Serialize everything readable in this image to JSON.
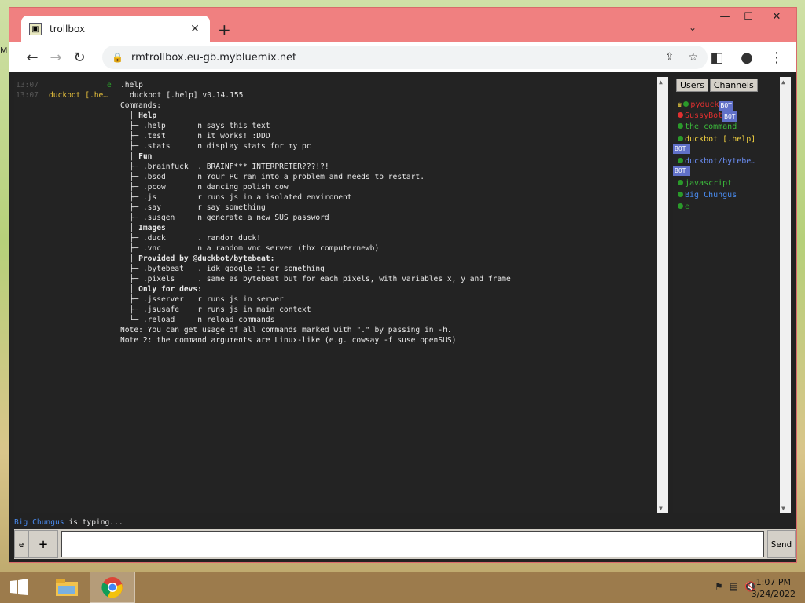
{
  "browser": {
    "tab_title": "trollbox",
    "tab_close": "✕",
    "new_tab": "+",
    "url": "rmtrollbox.eu-gb.mybluemix.net"
  },
  "desktop_label": "M",
  "chat": {
    "rows": [
      {
        "ts": "13:07",
        "nick": "e",
        "text": ".help",
        "cls": ""
      },
      {
        "ts": "13:07",
        "nick": "duckbot [.he…",
        "text": "duckbot [.help] v0.14.155",
        "cls": ""
      },
      {
        "text": "Commands:",
        "cls": ""
      },
      {
        "text": "  │ Help",
        "cls": "bold"
      },
      {
        "text": "  ├─ .help       n says this text",
        "cls": ""
      },
      {
        "text": "  ├─ .test       n it works! :DDD",
        "cls": ""
      },
      {
        "text": "  ├─ .stats      n display stats for my pc",
        "cls": ""
      },
      {
        "text": "  │ Fun",
        "cls": "bold"
      },
      {
        "text": "  ├─ .brainfuck  . BRAINF*** INTERPRETER???!?!",
        "cls": ""
      },
      {
        "text": "  ├─ .bsod       n Your PC ran into a problem and needs to restart.",
        "cls": ""
      },
      {
        "text": "  ├─ .pcow       n dancing polish cow",
        "cls": ""
      },
      {
        "text": "  ├─ .js         r runs js in a isolated enviroment",
        "cls": ""
      },
      {
        "text": "  ├─ .say        r say something",
        "cls": ""
      },
      {
        "text": "  ├─ .susgen     n generate a new SUS password",
        "cls": ""
      },
      {
        "text": "  │ Images",
        "cls": "bold"
      },
      {
        "text": "  ├─ .duck       . random duck!",
        "cls": ""
      },
      {
        "text": "  ├─ .vnc        n a random vnc server (thx computernewb)",
        "cls": ""
      },
      {
        "text": "  │ Provided by @duckbot/bytebeat:",
        "cls": "bold"
      },
      {
        "text": "  ├─ .bytebeat   . idk google it or something",
        "cls": ""
      },
      {
        "text": "  ├─ .pixels     . same as bytebeat but for each pixels, with variables x, y and frame",
        "cls": ""
      },
      {
        "text": "  │ Only for devs:",
        "cls": "bold"
      },
      {
        "text": "  ├─ .jsserver   r runs js in server",
        "cls": ""
      },
      {
        "text": "  ├─ .jsusafe    r runs js in main context",
        "cls": ""
      },
      {
        "text": "  └─ .reload     n reload commands",
        "cls": ""
      },
      {
        "text": "Note: You can get usage of all commands marked with \".\" by passing in -h.",
        "cls": ""
      },
      {
        "text": "Note 2: the command arguments are Linux-like (e.g. cowsay -f suse openSUS)",
        "cls": ""
      }
    ],
    "typing_user": "Big Chungus",
    "typing_text": " is typing...",
    "input_e": "e",
    "input_plus": "+",
    "send": "Send"
  },
  "sidebar": {
    "users_btn": "Users",
    "channels_btn": "Channels",
    "bot_label": "BOT",
    "users": [
      {
        "name": "pyduck",
        "color": "#e03030",
        "dot": "#2a9a2a",
        "bot": true,
        "crown": true
      },
      {
        "name": "SussyBot",
        "color": "#e03030",
        "dot": "#e03030",
        "bot": true
      },
      {
        "name": "the command",
        "color": "#3cbb3c",
        "dot": "#2a9a2a",
        "bot": false
      },
      {
        "name": "duckbot [.help]",
        "color": "#f0d040",
        "dot": "#2a9a2a",
        "bot": true
      },
      {
        "name": "duckbot/bytebe…",
        "color": "#6a8cf0",
        "dot": "#2a9a2a",
        "bot": true
      },
      {
        "name": "javascript",
        "color": "#3cbb3c",
        "dot": "#2a9a2a",
        "bot": false
      },
      {
        "name": "Big Chungus",
        "color": "#4a8cf0",
        "dot": "#2a9a2a",
        "bot": false
      },
      {
        "name": "e",
        "color": "#2a9a2a",
        "dot": "#2a9a2a",
        "bot": false
      }
    ]
  },
  "taskbar": {
    "time": "1:07 PM",
    "date": "3/24/2022"
  }
}
